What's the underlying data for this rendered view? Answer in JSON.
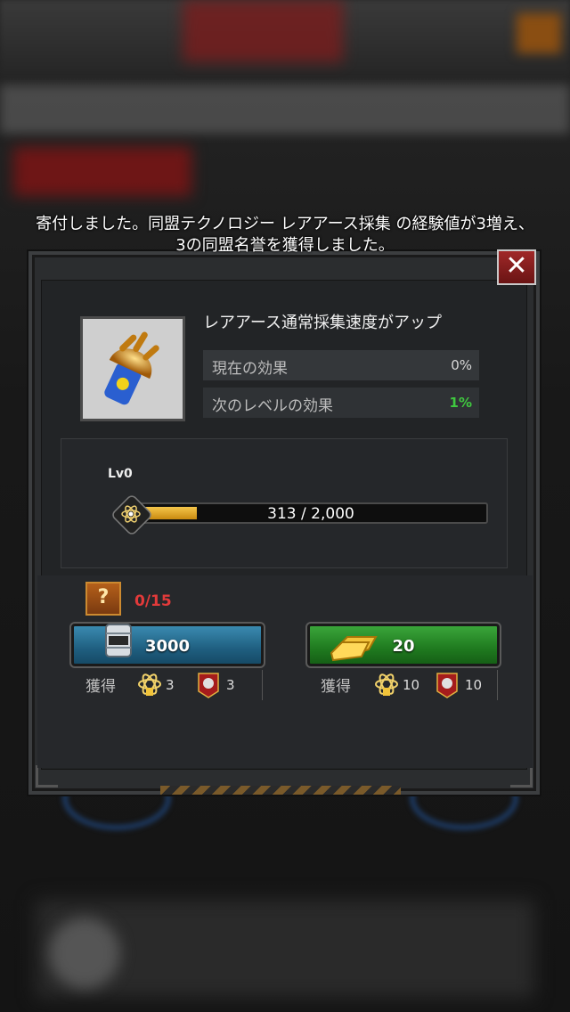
{
  "notice": {
    "line1": "寄付しました。同盟テクノロジー レアアース採集 の経験値が3増え、",
    "line2": "3の同盟名誉を獲得しました。"
  },
  "close": {
    "glyph": "✕",
    "icon": "close-icon"
  },
  "tech": {
    "title": "レアアース通常採集速度がアップ",
    "current_label": "現在の効果",
    "current_value": "0%",
    "next_label": "次のレベルの効果",
    "next_value": "1%",
    "icon": "drill-bit-icon"
  },
  "progress": {
    "level": "Lv0",
    "text": "313 / 2,000",
    "value": 313,
    "max": 2000
  },
  "donations": {
    "mystery_glyph": "?",
    "count": "0/15",
    "oil_button": {
      "value": "3000",
      "icon": "oil-barrel-icon"
    },
    "gold_button": {
      "value": "20",
      "icon": "gold-bar-icon"
    },
    "gain_label": "獲得",
    "oil_gain": {
      "tech_exp": "3",
      "honor": "3"
    },
    "gold_gain": {
      "tech_exp": "10",
      "honor": "10"
    }
  },
  "colors": {
    "green_text": "#3fc83f",
    "red_text": "#e23a3a",
    "bar_fill": "#e8b43a"
  }
}
